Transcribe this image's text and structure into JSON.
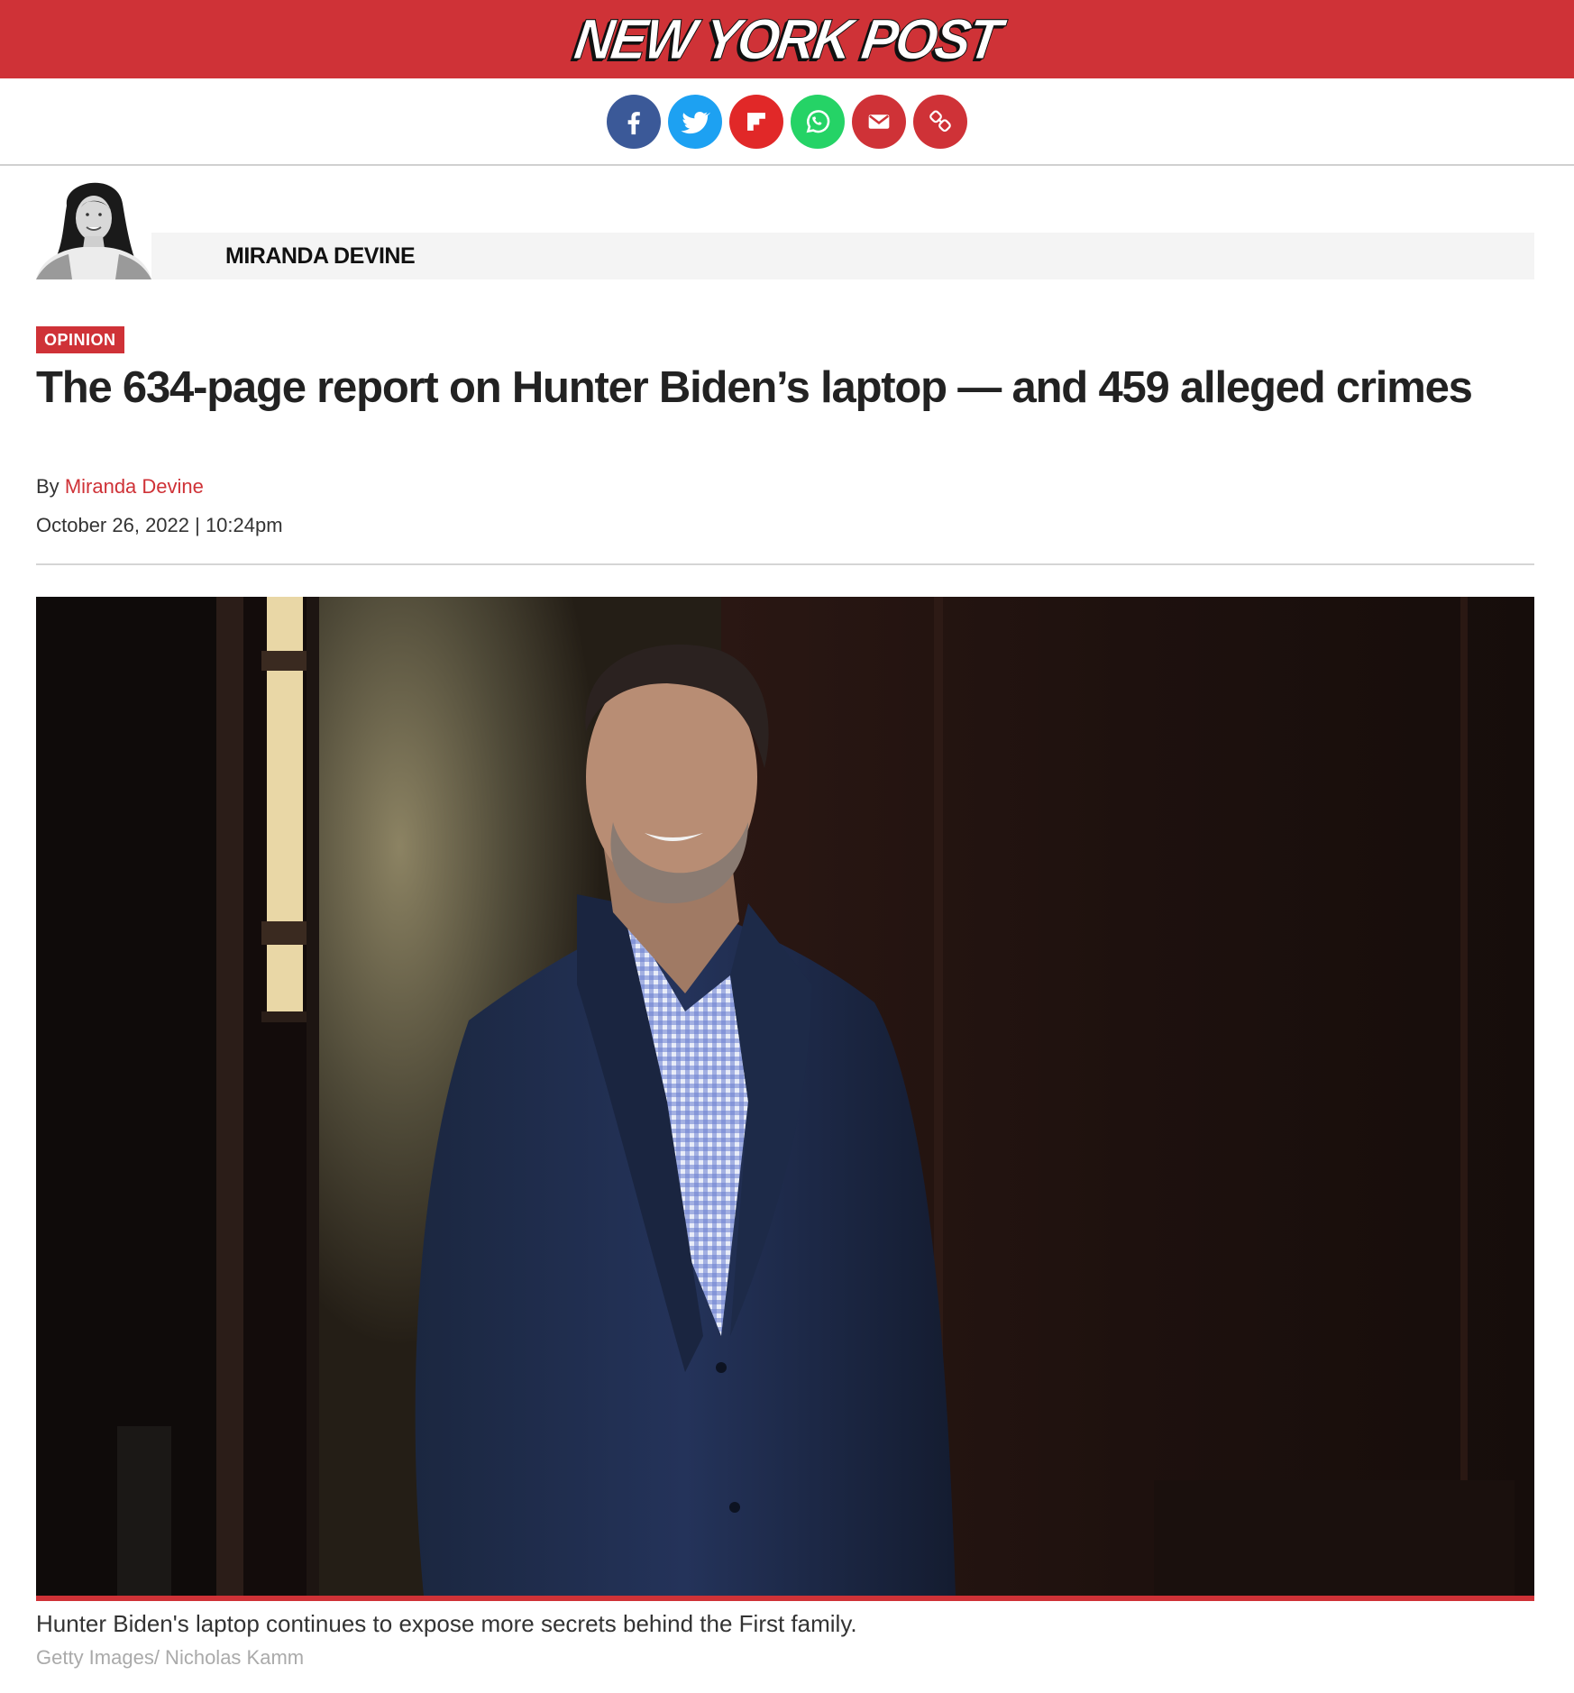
{
  "masthead": {
    "logo_text": "NEW YORK POST",
    "color": "#cf3237"
  },
  "share": {
    "buttons": [
      {
        "name": "facebook",
        "icon": "facebook-icon",
        "color": "#3b5998"
      },
      {
        "name": "twitter",
        "icon": "twitter-icon",
        "color": "#1da1f2"
      },
      {
        "name": "flipboard",
        "icon": "flipboard-icon",
        "color": "#e12828"
      },
      {
        "name": "whatsapp",
        "icon": "whatsapp-icon",
        "color": "#25d366"
      },
      {
        "name": "email",
        "icon": "envelope-icon",
        "color": "#cf3237"
      },
      {
        "name": "copy-link",
        "icon": "link-icon",
        "color": "#cf3237"
      }
    ]
  },
  "author": {
    "name": "MIRANDA DEVINE"
  },
  "article": {
    "tag": "OPINION",
    "headline": "The 634-page report on Hunter Biden’s laptop — and 459 alleged crimes",
    "byline_prefix": "By",
    "byline_author": "Miranda Devine",
    "date": "October 26, 2022 | 10:24pm"
  },
  "photo": {
    "caption": "Hunter Biden's laptop continues to expose more secrets behind the First family.",
    "credit": "Getty Images/ Nicholas Kamm"
  }
}
